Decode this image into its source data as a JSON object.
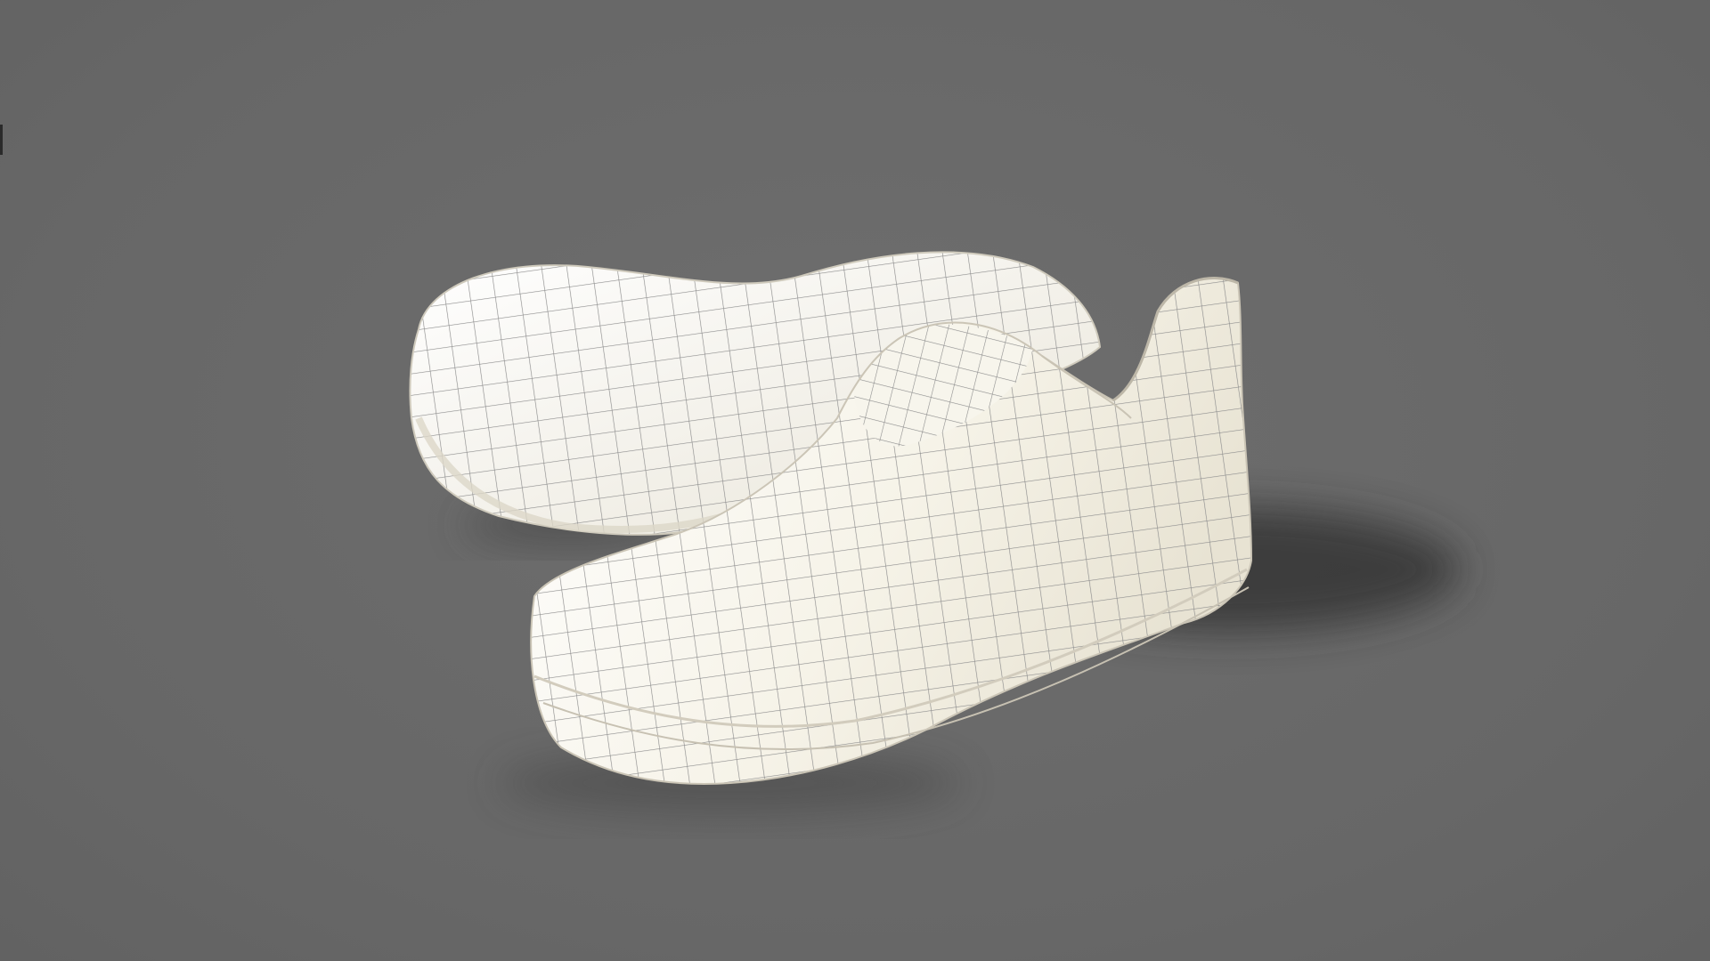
{
  "scene": {
    "background_color": "#6a6a6a",
    "mesh_fill": "#f4f1e6",
    "wire_color": "#8f8f8f",
    "shadow_color": "#2f2f2f",
    "objects": [
      "sneaker-sole-mesh",
      "sneaker-upper-mesh"
    ]
  }
}
